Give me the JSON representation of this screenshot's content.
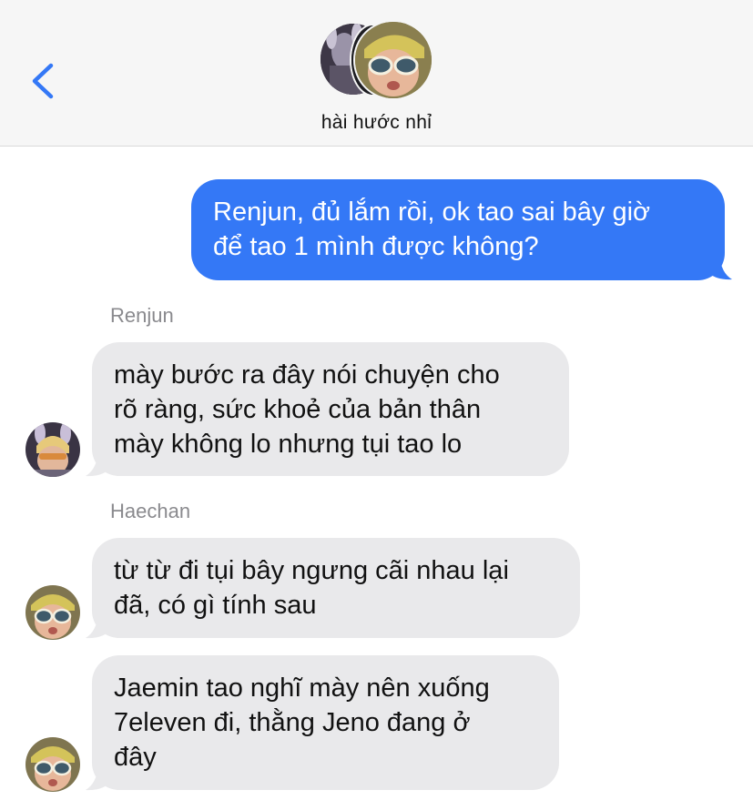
{
  "header": {
    "title": "hài hước nhỉ",
    "back_icon": "chevron-left-icon",
    "accent": "#3478f6"
  },
  "messages": [
    {
      "direction": "outgoing",
      "lines": [
        "Renjun, đủ lắm rồi, ok tao sai bây giờ",
        "để tao 1 mình được không?"
      ]
    },
    {
      "direction": "incoming",
      "sender": "Renjun",
      "lines": [
        "mày bước ra đây nói chuyện cho",
        "rõ ràng, sức khoẻ của bản thân",
        "mày không lo nhưng tụi tao lo"
      ]
    },
    {
      "direction": "incoming",
      "sender": "Haechan",
      "lines": [
        "từ từ đi tụi bây ngưng cãi nhau lại",
        "đã, có gì tính sau"
      ]
    },
    {
      "direction": "incoming",
      "sender": "Haechan",
      "lines": [
        "Jaemin tao nghĩ mày nên xuống",
        "7eleven đi, thằng Jeno đang ở",
        "đây"
      ]
    }
  ],
  "colors": {
    "outgoing_bubble": "#3478f6",
    "incoming_bubble": "#e9e9eb",
    "sender_name": "#8a8a8e"
  }
}
